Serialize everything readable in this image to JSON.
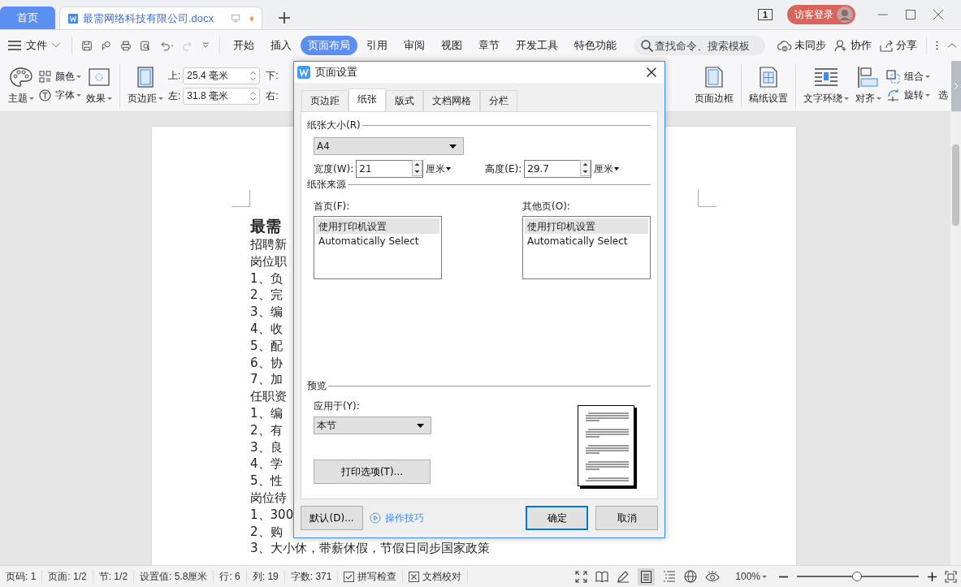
{
  "tabs": [
    {
      "label": "首页",
      "kind": "home",
      "selected": false
    },
    {
      "label": "最需网络科技有限公司.docx",
      "kind": "doc",
      "selected": true,
      "unsaved": true
    }
  ],
  "title_bar": {
    "page_count": "1",
    "login": "访客登录"
  },
  "menu": {
    "file": "文件",
    "tabs": [
      {
        "label": "开始",
        "selected": false
      },
      {
        "label": "插入",
        "selected": false
      },
      {
        "label": "页面布局",
        "selected": true
      },
      {
        "label": "引用",
        "selected": false
      },
      {
        "label": "审阅",
        "selected": false
      },
      {
        "label": "视图",
        "selected": false
      },
      {
        "label": "章节",
        "selected": false
      },
      {
        "label": "开发工具",
        "selected": false
      },
      {
        "label": "特色功能",
        "selected": false
      }
    ],
    "search": {
      "placeholder": "查找命令、搜索模板"
    },
    "actions": [
      "未同步",
      "协作",
      "分享"
    ]
  },
  "ribbon": {
    "theme": "主题",
    "color_scheme": "颜色",
    "font": "字体",
    "effect": "效果",
    "margins": "页边距",
    "top": {
      "label": "上:",
      "value": "25.4 毫米"
    },
    "left": {
      "label": "左:",
      "value": "31.8 毫米"
    },
    "bottom_label": "下:",
    "right_label": "右:",
    "right_tools": [
      "页面边框",
      "稿纸设置",
      "文字环绕",
      "对齐"
    ],
    "group": "组合",
    "rotate": "旋转",
    "select": "选"
  },
  "document": {
    "heading": "最需",
    "lines": [
      "招聘新",
      "岗位职",
      "1、负",
      "2、完",
      "3、编",
      "4、收",
      "5、配",
      "6、协",
      "7、加",
      "任职资",
      "1、编",
      "2、有",
      "3、良",
      "4、学",
      "5、性",
      "岗位待",
      "1、300",
      "2、购",
      "3、大小休，带薪休假，节假日同步国家政策"
    ]
  },
  "dialog": {
    "title": "页面设置",
    "tabs": [
      {
        "label": "页边距",
        "selected": false
      },
      {
        "label": "纸张",
        "selected": true
      },
      {
        "label": "版式",
        "selected": false
      },
      {
        "label": "文档网格",
        "selected": false
      },
      {
        "label": "分栏",
        "selected": false
      }
    ],
    "paper_size": {
      "heading": "纸张大小(R)",
      "value": "A4",
      "width": {
        "label": "宽度(W):",
        "value": "21",
        "unit": "厘米"
      },
      "height": {
        "label": "高度(E):",
        "value": "29.7",
        "unit": "厘米"
      }
    },
    "paper_source": {
      "heading": "纸张来源",
      "lists": [
        {
          "label": "首页(F):",
          "items": [
            {
              "text": "使用打印机设置",
              "selected": true
            },
            {
              "text": "Automatically Select",
              "selected": false
            }
          ]
        },
        {
          "label": "其他页(O):",
          "items": [
            {
              "text": "使用打印机设置",
              "selected": true
            },
            {
              "text": "Automatically Select",
              "selected": false
            }
          ]
        }
      ]
    },
    "preview": {
      "heading": "预览",
      "apply_label": "应用于(Y):",
      "apply_value": "本节",
      "print_options": "打印选项(T)..."
    },
    "buttons": {
      "default": "默认(D)...",
      "tips": "操作技巧",
      "ok": "确定",
      "cancel": "取消"
    }
  },
  "status_bar": {
    "items": [
      "页码: 1",
      "页面: 1/2",
      "节: 1/2",
      "设置值: 5.8厘米",
      "行: 6",
      "列: 19",
      "字数: 371"
    ],
    "spell": "拼写检查",
    "proof": "文档校对",
    "zoom": "100%",
    "level": 0.49
  }
}
